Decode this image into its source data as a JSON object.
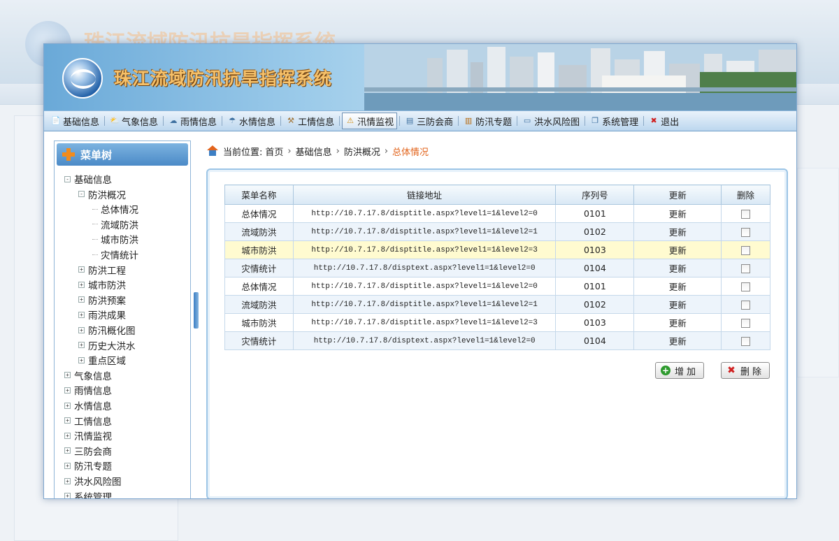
{
  "app": {
    "title": "珠江流域防汛抗旱指挥系统"
  },
  "nav": {
    "items": [
      {
        "label": "基础信息",
        "icon": "document-icon"
      },
      {
        "label": "气象信息",
        "icon": "weather-cloud-icon"
      },
      {
        "label": "雨情信息",
        "icon": "rain-cloud-icon"
      },
      {
        "label": "水情信息",
        "icon": "water-drop-icon"
      },
      {
        "label": "工情信息",
        "icon": "hammer-icon"
      },
      {
        "label": "汛情监视",
        "icon": "monitor-icon",
        "active": true
      },
      {
        "label": "三防会商",
        "icon": "conference-icon"
      },
      {
        "label": "防汛专题",
        "icon": "book-icon"
      },
      {
        "label": "洪水风险图",
        "icon": "map-icon"
      },
      {
        "label": "系统管理",
        "icon": "window-icon"
      },
      {
        "label": "退出",
        "icon": "exit-icon"
      }
    ]
  },
  "sidebar": {
    "title": "菜单树",
    "tree": [
      {
        "label": "基础信息",
        "level": 0,
        "toggle": "-"
      },
      {
        "label": "防洪概况",
        "level": 1,
        "toggle": "-"
      },
      {
        "label": "总体情况",
        "level": 2,
        "toggle": ""
      },
      {
        "label": "流域防洪",
        "level": 2,
        "toggle": ""
      },
      {
        "label": "城市防洪",
        "level": 2,
        "toggle": ""
      },
      {
        "label": "灾情统计",
        "level": 2,
        "toggle": ""
      },
      {
        "label": "防洪工程",
        "level": 1,
        "toggle": "+"
      },
      {
        "label": "城市防洪",
        "level": 1,
        "toggle": "+"
      },
      {
        "label": "防洪预案",
        "level": 1,
        "toggle": "+"
      },
      {
        "label": "雨洪成果",
        "level": 1,
        "toggle": "+"
      },
      {
        "label": "防汛概化图",
        "level": 1,
        "toggle": "+"
      },
      {
        "label": "历史大洪水",
        "level": 1,
        "toggle": "+"
      },
      {
        "label": "重点区域",
        "level": 1,
        "toggle": "+"
      },
      {
        "label": "气象信息",
        "level": 0,
        "toggle": "+"
      },
      {
        "label": "雨情信息",
        "level": 0,
        "toggle": "+"
      },
      {
        "label": "水情信息",
        "level": 0,
        "toggle": "+"
      },
      {
        "label": "工情信息",
        "level": 0,
        "toggle": "+"
      },
      {
        "label": "汛情监视",
        "level": 0,
        "toggle": "+"
      },
      {
        "label": "三防会商",
        "level": 0,
        "toggle": "+"
      },
      {
        "label": "防汛专题",
        "level": 0,
        "toggle": "+"
      },
      {
        "label": "洪水风险图",
        "level": 0,
        "toggle": "+"
      },
      {
        "label": "系统管理",
        "level": 0,
        "toggle": "+"
      }
    ]
  },
  "breadcrumb": {
    "prefix": "当前位置:",
    "items": [
      "首页",
      "基础信息",
      "防洪概况"
    ],
    "current": "总体情况"
  },
  "table": {
    "headers": [
      "菜单名称",
      "链接地址",
      "序列号",
      "更新",
      "删除"
    ],
    "rows": [
      {
        "name": "总体情况",
        "url": "http://10.7.17.8/disptitle.aspx?level1=1&level2=0",
        "seq": "0101",
        "update": "更新"
      },
      {
        "name": "流域防洪",
        "url": "http://10.7.17.8/disptitle.aspx?level1=1&level2=1",
        "seq": "0102",
        "update": "更新"
      },
      {
        "name": "城市防洪",
        "url": "http://10.7.17.8/disptitle.aspx?level1=1&level2=3",
        "seq": "0103",
        "update": "更新",
        "highlight": true
      },
      {
        "name": "灾情统计",
        "url": "http://10.7.17.8/disptext.aspx?level1=1&level2=0",
        "seq": "0104",
        "update": "更新"
      },
      {
        "name": "总体情况",
        "url": "http://10.7.17.8/disptitle.aspx?level1=1&level2=0",
        "seq": "0101",
        "update": "更新"
      },
      {
        "name": "流域防洪",
        "url": "http://10.7.17.8/disptitle.aspx?level1=1&level2=1",
        "seq": "0102",
        "update": "更新"
      },
      {
        "name": "城市防洪",
        "url": "http://10.7.17.8/disptitle.aspx?level1=1&level2=3",
        "seq": "0103",
        "update": "更新"
      },
      {
        "name": "灾情统计",
        "url": "http://10.7.17.8/disptext.aspx?level1=1&level2=0",
        "seq": "0104",
        "update": "更新"
      }
    ]
  },
  "actions": {
    "add_label": "增加",
    "delete_label": "删除"
  },
  "colors": {
    "accent": "#3d7fc4",
    "breadcrumb_current": "#e2641c",
    "row_highlight": "#fffbd0"
  }
}
